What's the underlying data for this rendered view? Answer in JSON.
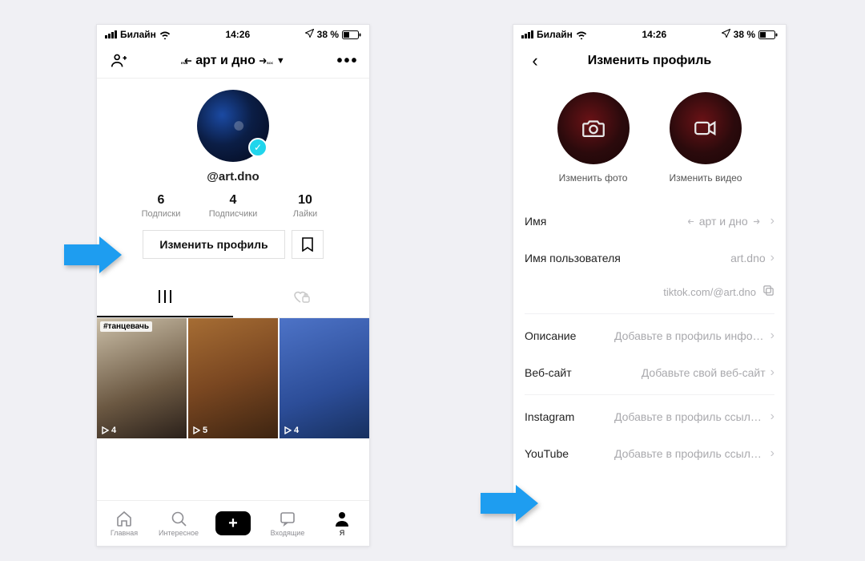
{
  "status": {
    "carrier": "Билайн",
    "time": "14:26",
    "battery_text": "38 %"
  },
  "left": {
    "title": "арт и дно",
    "handle": "@art.dno",
    "stats": {
      "subs": {
        "num": "6",
        "label": "Подписки"
      },
      "followers": {
        "num": "4",
        "label": "Подписчики"
      },
      "likes": {
        "num": "10",
        "label": "Лайки"
      }
    },
    "edit_label": "Изменить профиль",
    "videos": [
      {
        "tag": "#танцевачь",
        "plays": "4"
      },
      {
        "tag": "",
        "plays": "5"
      },
      {
        "tag": "",
        "plays": "4"
      }
    ],
    "tabbar": {
      "home": "Главная",
      "disc": "Интересное",
      "inbox": "Входящие",
      "me": "Я"
    }
  },
  "right": {
    "title": "Изменить профиль",
    "change_photo": "Изменить фото",
    "change_video": "Изменить видео",
    "rows": {
      "name": {
        "k": "Имя",
        "v": "арт и дно"
      },
      "username": {
        "k": "Имя пользователя",
        "v": "art.dno"
      },
      "link": {
        "v": "tiktok.com/@art.dno"
      },
      "bio": {
        "k": "Описание",
        "v": "Добавьте в профиль информа…"
      },
      "website": {
        "k": "Веб-сайт",
        "v": "Добавьте свой веб-сайт"
      },
      "instagram": {
        "k": "Instagram",
        "v": "Добавьте в профиль ссылку н…"
      },
      "youtube": {
        "k": "YouTube",
        "v": "Добавьте в профиль ссылку н…"
      }
    }
  }
}
